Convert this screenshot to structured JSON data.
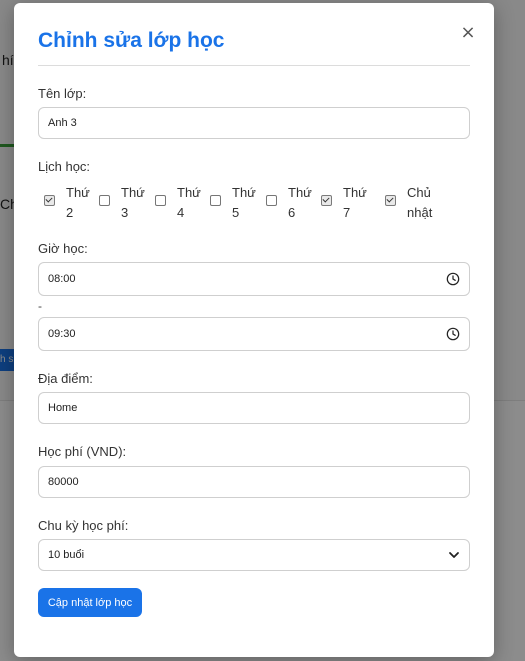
{
  "background": {
    "text_top": "hí",
    "text_mid": "Chủ",
    "button_text": "h s"
  },
  "modal": {
    "title": "Chỉnh sửa lớp học",
    "close_icon": "×",
    "class_name": {
      "label": "Tên lớp:",
      "value": "Anh 3"
    },
    "schedule": {
      "label": "Lịch học:",
      "days": [
        {
          "label": "Thứ 2",
          "checked": true
        },
        {
          "label": "Thứ 3",
          "checked": false
        },
        {
          "label": "Thứ 4",
          "checked": false
        },
        {
          "label": "Thứ 5",
          "checked": false
        },
        {
          "label": "Thứ 6",
          "checked": false
        },
        {
          "label": "Thứ 7",
          "checked": true
        },
        {
          "label": "Chủ nhật",
          "checked": true
        }
      ]
    },
    "time": {
      "label": "Giờ học:",
      "start": "08:00",
      "separator": "-",
      "end": "09:30"
    },
    "location": {
      "label": "Địa điểm:",
      "value": "Home"
    },
    "fee": {
      "label": "Học phí (VND):",
      "value": "80000"
    },
    "fee_cycle": {
      "label": "Chu kỳ học phí:",
      "value": "10 buổi"
    },
    "submit_label": "Cập nhật lớp học"
  },
  "colors": {
    "accent": "#1a73e8",
    "overlay": "rgba(0,0,0,0.45)"
  }
}
